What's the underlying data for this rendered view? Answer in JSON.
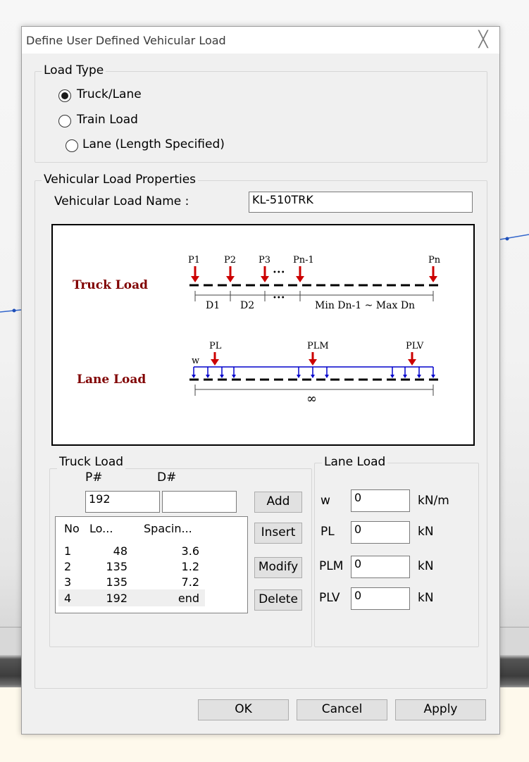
{
  "dialog": {
    "title": "Define User Defined Vehicular Load",
    "close_glyph": "╳"
  },
  "load_type": {
    "label": "Load Type",
    "options": [
      {
        "label": "Truck/Lane",
        "checked": true
      },
      {
        "label": "Train Load",
        "checked": false
      },
      {
        "label": "Lane (Length Specified)",
        "checked": false
      }
    ]
  },
  "properties": {
    "label": "Vehicular Load Properties",
    "name_label": "Vehicular Load Name :",
    "name_value": "KL-510TRK"
  },
  "diagram": {
    "truck_label": "Truck Load",
    "lane_label": "Lane Load",
    "p1": "P1",
    "p2": "P2",
    "p3": "P3",
    "pn1": "Pn-1",
    "pn": "Pn",
    "d1": "D1",
    "d2": "D2",
    "dn": "Min Dn-1 ~ Max Dn",
    "dots": "•••",
    "w": "w",
    "pl": "PL",
    "plm": "PLM",
    "plv": "PLV",
    "infinity": "∞",
    "red": "#cc0000",
    "blue": "#0000cc",
    "label_color": "#800000"
  },
  "truck_load": {
    "label": "Truck Load",
    "p_label": "P#",
    "d_label": "D#",
    "p_value": "192",
    "d_value": "",
    "columns": [
      "No",
      "Lo...",
      "Spacin..."
    ],
    "rows": [
      [
        "1",
        "48",
        "3.6"
      ],
      [
        "2",
        "135",
        "1.2"
      ],
      [
        "3",
        "135",
        "7.2"
      ],
      [
        "4",
        "192",
        "end"
      ]
    ],
    "buttons": {
      "add": "Add",
      "insert": "Insert",
      "modify": "Modify",
      "delete": "Delete"
    }
  },
  "lane_load": {
    "label": "Lane Load",
    "fields": [
      {
        "label": "w",
        "value": "0",
        "unit": "kN/m"
      },
      {
        "label": "PL",
        "value": "0",
        "unit": "kN"
      },
      {
        "label": "PLM",
        "value": "0",
        "unit": "kN"
      },
      {
        "label": "PLV",
        "value": "0",
        "unit": "kN"
      }
    ]
  },
  "footer": {
    "ok": "OK",
    "cancel": "Cancel",
    "apply": "Apply"
  }
}
